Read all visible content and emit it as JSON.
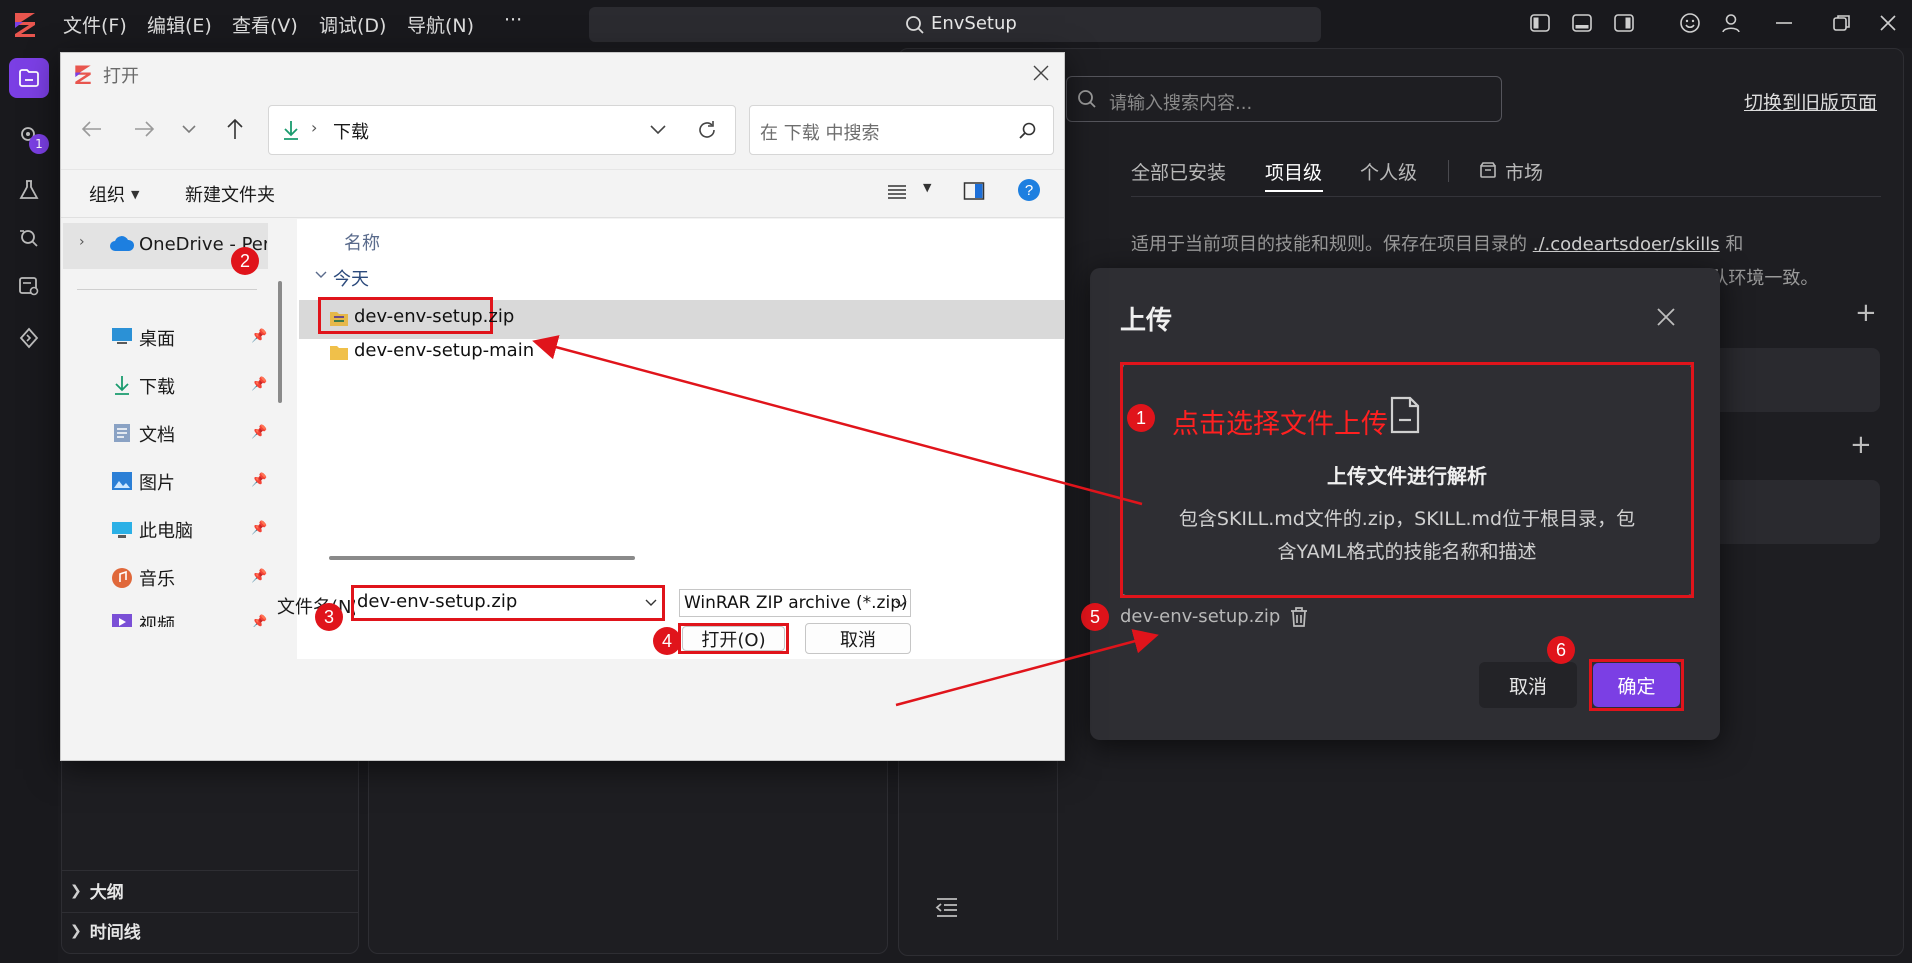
{
  "titlebar": {
    "menus": [
      "文件(F)",
      "编辑(E)",
      "查看(V)",
      "调试(D)",
      "导航(N)",
      "···"
    ],
    "search_text": "EnvSetup"
  },
  "activity_bar": {
    "badge": "1"
  },
  "left_panels": {
    "outline": "大纲",
    "timeline": "时间线"
  },
  "skills_page": {
    "search_placeholder": "请输入搜索内容...",
    "switch_link": "切换到旧版页面",
    "tabs": [
      "全部已安装",
      "项目级",
      "个人级",
      "市场"
    ],
    "active_tab": "项目级",
    "desc_prefix": "适用于当前项目的技能和规则。保存在项目目录的 ",
    "desc_link": "./.codeartsdoer/skills",
    "desc_suffix": " 和",
    "desc_line2": "./.codeartsdoer/rule 中，支持目录中快捷管理，随代码库分发，确保团队环境一致。",
    "plus": "+"
  },
  "upload_modal": {
    "title": "上传",
    "annotation_text": "点击选择文件上传",
    "drop_title": "上传文件进行解析",
    "drop_desc_line1": "包含SKILL.md文件的.zip，SKILL.md位于根目录，包",
    "drop_desc_line2": "含YAML格式的技能名称和描述",
    "selected_file": "dev-env-setup.zip",
    "cancel_label": "取消",
    "confirm_label": "确定",
    "accent_color": "#7b3fe4"
  },
  "file_dialog": {
    "title": "打开",
    "location": "下载",
    "search_placeholder": "在 下载 中搜索",
    "organize_label": "组织",
    "new_folder_label": "新建文件夹",
    "nav_onedrive": "OneDrive - Per",
    "nav_items": [
      "桌面",
      "下载",
      "文档",
      "图片",
      "此电脑",
      "音乐",
      "视频"
    ],
    "column_name": "名称",
    "group_today": "今天",
    "files": [
      "dev-env-setup.zip",
      "dev-env-setup-main"
    ],
    "filename_label": "文件名(N):",
    "filename_value": "dev-env-setup.zip",
    "filetype_value": "WinRAR ZIP archive (*.zip)",
    "open_label": "打开(O)",
    "cancel_label": "取消"
  },
  "markers": [
    "1",
    "2",
    "3",
    "4",
    "5",
    "6"
  ]
}
